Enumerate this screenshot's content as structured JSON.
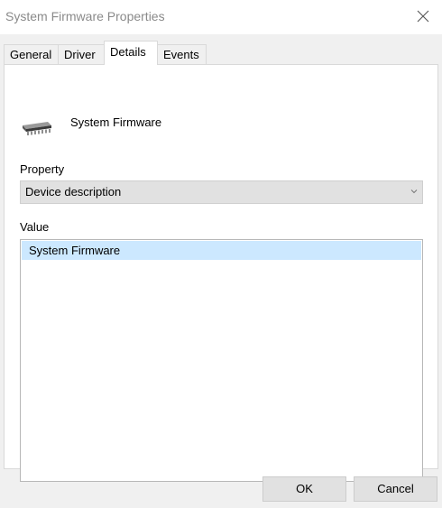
{
  "window": {
    "title": "System Firmware Properties",
    "close_icon": "close-icon"
  },
  "tabs": [
    {
      "label": "General",
      "active": false
    },
    {
      "label": "Driver",
      "active": false
    },
    {
      "label": "Details",
      "active": true
    },
    {
      "label": "Events",
      "active": false
    }
  ],
  "details": {
    "device_icon": "chip-icon",
    "device_name": "System Firmware",
    "property_label": "Property",
    "property_selected": "Device description",
    "value_label": "Value",
    "values": [
      "System Firmware"
    ]
  },
  "buttons": {
    "ok": "OK",
    "cancel": "Cancel"
  },
  "colors": {
    "selection": "#cce8ff",
    "dialog_bg": "#f0f0f0",
    "button_bg": "#e1e1e1",
    "title_text": "#8a8a8a"
  }
}
